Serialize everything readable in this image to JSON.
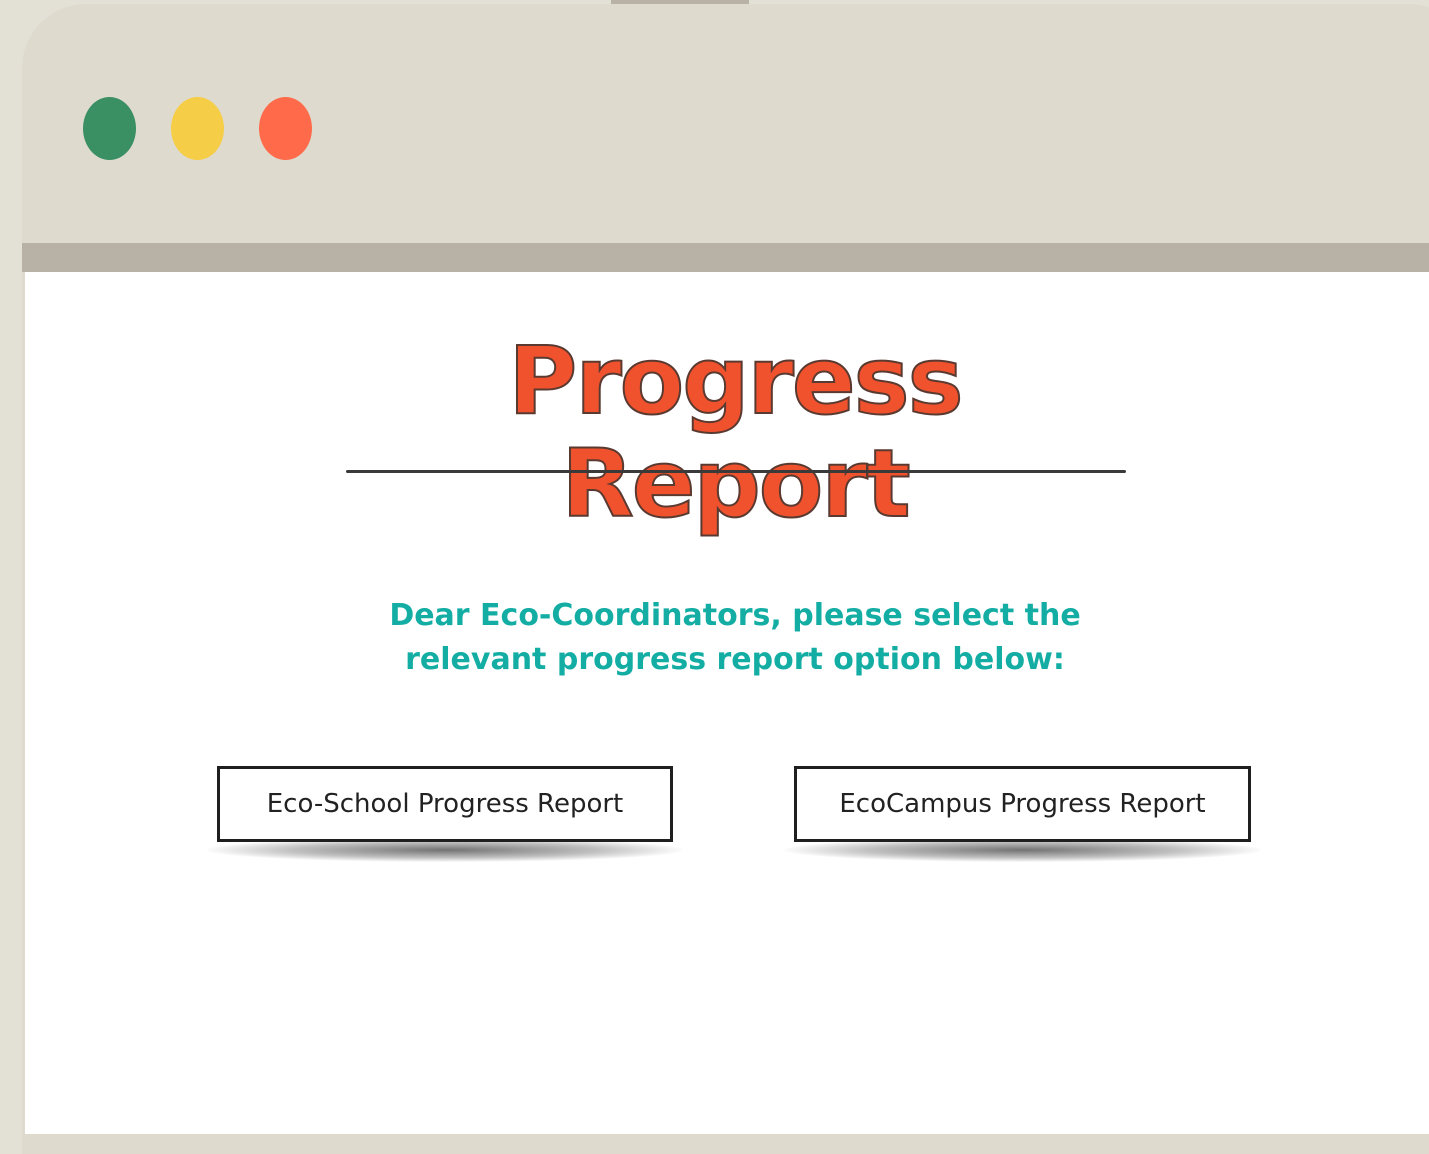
{
  "window": {
    "controls": [
      {
        "name": "green",
        "color": "#3a8f63"
      },
      {
        "name": "yellow",
        "color": "#f6cd46"
      },
      {
        "name": "red",
        "color": "#ff6b4a"
      }
    ]
  },
  "page": {
    "title": "Progress Report",
    "instruction_line1": "Dear Eco-Coordinators, please select the",
    "instruction_line2": "relevant progress report option below:",
    "buttons": {
      "eco_school": "Eco-School Progress Report",
      "eco_campus": "EcoCampus Progress Report"
    }
  },
  "colors": {
    "title": "#f0522e",
    "instruction": "#13ada4",
    "frame": "#dedace",
    "divider": "#b8b2a6"
  }
}
